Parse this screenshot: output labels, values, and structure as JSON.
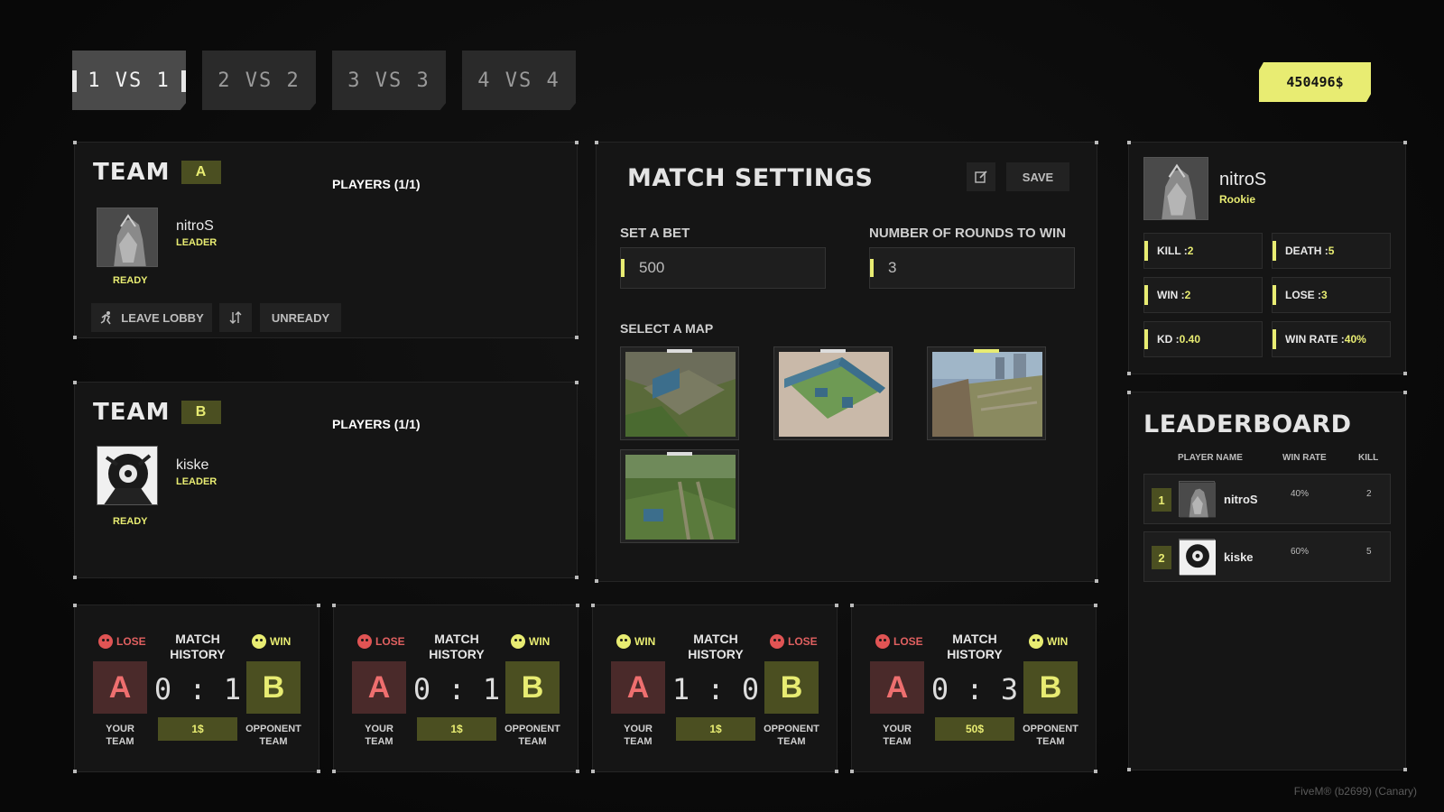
{
  "modes": [
    {
      "label": "1 VS 1",
      "active": true
    },
    {
      "label": "2 VS 2",
      "active": false
    },
    {
      "label": "3 VS 3",
      "active": false
    },
    {
      "label": "4 VS 4",
      "active": false
    }
  ],
  "balance": "450496$",
  "team_a": {
    "word": "TEAM",
    "letter": "A",
    "players": "PLAYERS (1/1)",
    "player": {
      "name": "nitroS",
      "role": "LEADER",
      "status": "READY"
    },
    "buttons": {
      "leave": "LEAVE LOBBY",
      "unready": "UNREADY"
    }
  },
  "team_b": {
    "word": "TEAM",
    "letter": "B",
    "players": "PLAYERS (1/1)",
    "player": {
      "name": "kiske",
      "role": "LEADER",
      "status": "READY"
    }
  },
  "settings": {
    "title": "MATCH SETTINGS",
    "save": "SAVE",
    "bet_label": "SET A BET",
    "bet_value": "500",
    "rounds_label": "NUMBER OF ROUNDS TO WIN",
    "rounds_value": "3",
    "map_label": "SELECT A MAP"
  },
  "profile": {
    "name": "nitroS",
    "rank": "Rookie",
    "stats": [
      {
        "label": "KILL : ",
        "value": "2"
      },
      {
        "label": "DEATH : ",
        "value": "5"
      },
      {
        "label": "WIN : ",
        "value": "2"
      },
      {
        "label": "LOSE : ",
        "value": "3"
      },
      {
        "label": "KD : ",
        "value": "0.40"
      },
      {
        "label": "WIN RATE : ",
        "value": "40%"
      }
    ]
  },
  "leaderboard": {
    "title": "LEADERBOARD",
    "headers": {
      "name": "PLAYER NAME",
      "rate": "WIN RATE",
      "kill": "KILL"
    },
    "rows": [
      {
        "rank": "1",
        "name": "nitroS",
        "rate": "40%",
        "kill": "2"
      },
      {
        "rank": "2",
        "name": "kiske",
        "rate": "60%",
        "kill": "5"
      }
    ]
  },
  "history": [
    {
      "left": "LOSE",
      "right": "WIN",
      "title1": "MATCH",
      "title2": "HISTORY",
      "score": "0 : 1",
      "bet": "1$",
      "yt1": "YOUR",
      "yt2": "TEAM",
      "ot1": "OPPONENT",
      "ot2": "TEAM",
      "a": "A",
      "b": "B"
    },
    {
      "left": "LOSE",
      "right": "WIN",
      "title1": "MATCH",
      "title2": "HISTORY",
      "score": "0 : 1",
      "bet": "1$",
      "yt1": "YOUR",
      "yt2": "TEAM",
      "ot1": "OPPONENT",
      "ot2": "TEAM",
      "a": "A",
      "b": "B"
    },
    {
      "left": "WIN",
      "right": "LOSE",
      "title1": "MATCH",
      "title2": "HISTORY",
      "score": "1 : 0",
      "bet": "1$",
      "yt1": "YOUR",
      "yt2": "TEAM",
      "ot1": "OPPONENT",
      "ot2": "TEAM",
      "a": "A",
      "b": "B"
    },
    {
      "left": "LOSE",
      "right": "WIN",
      "title1": "MATCH",
      "title2": "HISTORY",
      "score": "0 : 3",
      "bet": "50$",
      "yt1": "YOUR",
      "yt2": "TEAM",
      "ot1": "OPPONENT",
      "ot2": "TEAM",
      "a": "A",
      "b": "B"
    }
  ],
  "footer": "FiveM® (b2699) (Canary)",
  "colors": {
    "accent": "#e8ec72",
    "lose": "#e06060",
    "panel": "#151515"
  }
}
